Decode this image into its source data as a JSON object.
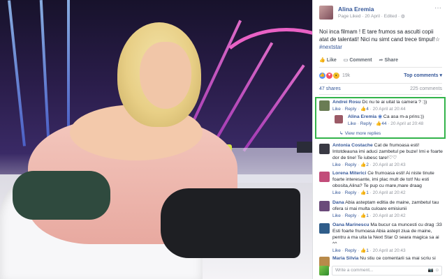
{
  "post": {
    "page_name": "Alina Eremia",
    "meta_prefix": "Page Liked",
    "date": "20 April",
    "edited": "Edited",
    "text": "Noi inca filmam ! E tare frumos sa asculti copii atat de talentati! Nici nu simt cand trece timpul!☆",
    "hashtag": "#nextstar"
  },
  "actions": {
    "like": "Like",
    "comment": "Comment",
    "share": "Share"
  },
  "reactions": {
    "count": "19k",
    "top_comments": "Top comments ▾"
  },
  "stats": {
    "shares": "47 shares",
    "comments": "225 comments"
  },
  "comments": [
    {
      "name": "Andrei Rosu",
      "text": "Dc nu te ai uitat la camera ? :))",
      "like": "Like",
      "reply": "Reply",
      "likes": "4",
      "time": "20 April at 20:44",
      "avatar_color": "#6a7c54"
    },
    {
      "name": "Alina Eremia",
      "text": "Ca asa m-a prins:))",
      "like": "Like",
      "reply": "Reply",
      "likes": "44",
      "time": "20 April at 20:48",
      "avatar_color": "#9b5a66"
    },
    {
      "view_more": "View more replies"
    },
    {
      "name": "Antonia Costache",
      "text": "Cat de frumoasa esti! Intotdeauna imi aduci zambetul pe buze! Imi e foarte dor de tine! Te iubesc tare!♡♡",
      "like": "Like",
      "reply": "Reply",
      "likes": "2",
      "time": "20 April at 20:43",
      "avatar_color": "#3a3a44"
    },
    {
      "name": "Lorena Miterici",
      "text": "Ce frumoasa esti! Ai niste tinute foarte interesante, imi plac mult de tot! Nu esti obosita,Alina? Te pup cu mare,mare draag",
      "like": "Like",
      "reply": "Reply",
      "likes": "1",
      "time": "20 April at 20:42",
      "avatar_color": "#c24d7a"
    },
    {
      "name": "Dana",
      "text": "Abia asteptam editia de maine, zambetul tau ofera si mai multa culoare emisiunii",
      "like": "Like",
      "reply": "Reply",
      "likes": "1",
      "time": "20 April at 20:42",
      "avatar_color": "#6a4a7a"
    },
    {
      "name": "Oana Marinescu",
      "text": "Ma bucur ca muncesti cu drag :33 Esti foarte frumoasa Abia astept ziua de maine, pentru a ma uita la Next Star O seara magica sa ai ^^",
      "like": "Like",
      "reply": "Reply",
      "likes": "1",
      "time": "20 April at 20:43",
      "avatar_color": "#2f5d8a"
    },
    {
      "name": "Maria Silvia",
      "text": "Nu stiu ce comentarii sa mai scriu si",
      "avatar_color": "#b88a4a"
    }
  ],
  "composer": {
    "placeholder": "Write a comment..."
  }
}
